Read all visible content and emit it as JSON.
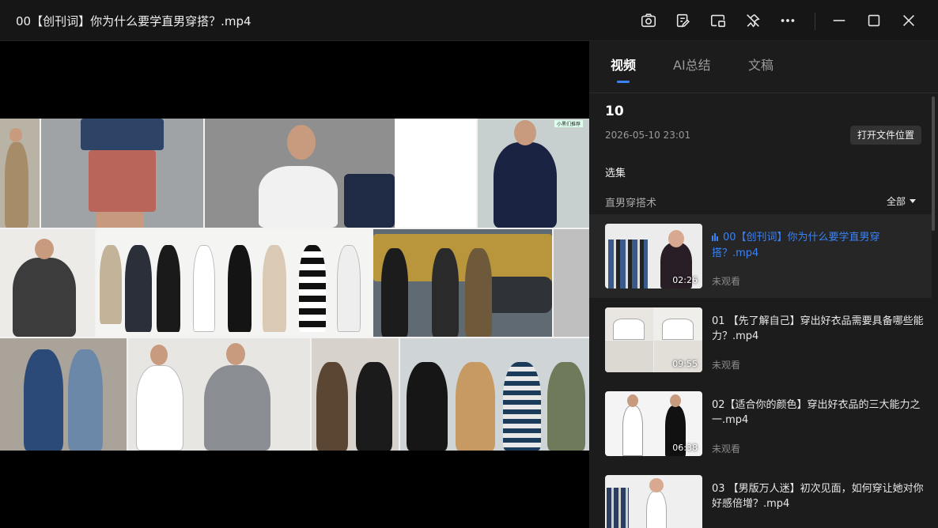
{
  "window": {
    "title": "00【创刊词】你为什么要学直男穿搭？.mp4",
    "icons": [
      "camera-icon",
      "edit-note-icon",
      "picture-in-picture-icon",
      "pin-off-icon",
      "more-icon",
      "minimize-icon",
      "maximize-icon",
      "close-icon"
    ]
  },
  "sidebar": {
    "tabs": [
      {
        "label": "视频",
        "active": true
      },
      {
        "label": "AI总结",
        "active": false
      },
      {
        "label": "文稿",
        "active": false
      }
    ],
    "count": "10",
    "date": "2026-05-10 23:01",
    "open_location_label": "打开文件位置",
    "section_title": "选集",
    "series_name": "直男穿搭术",
    "filter_label": "全部",
    "accent_color": "#3b82f6",
    "items": [
      {
        "title": "00【创刊词】你为什么要学直男穿搭？.mp4",
        "duration": "02:26",
        "status": "未观看",
        "active": true
      },
      {
        "title": "01 【先了解自己】穿出好衣品需要具备哪些能力？.mp4",
        "duration": "09:55",
        "status": "未观看",
        "active": false
      },
      {
        "title": "02【适合你的颜色】穿出好衣品的三大能力之一.mp4",
        "duration": "06:38",
        "status": "未观看",
        "active": false
      },
      {
        "title": "03 【男版万人迷】初次见面，如何穿让她对你好感倍增？.mp4",
        "duration": "",
        "status": "",
        "active": false
      }
    ]
  },
  "video": {
    "watermark": "小黑们推荐"
  }
}
